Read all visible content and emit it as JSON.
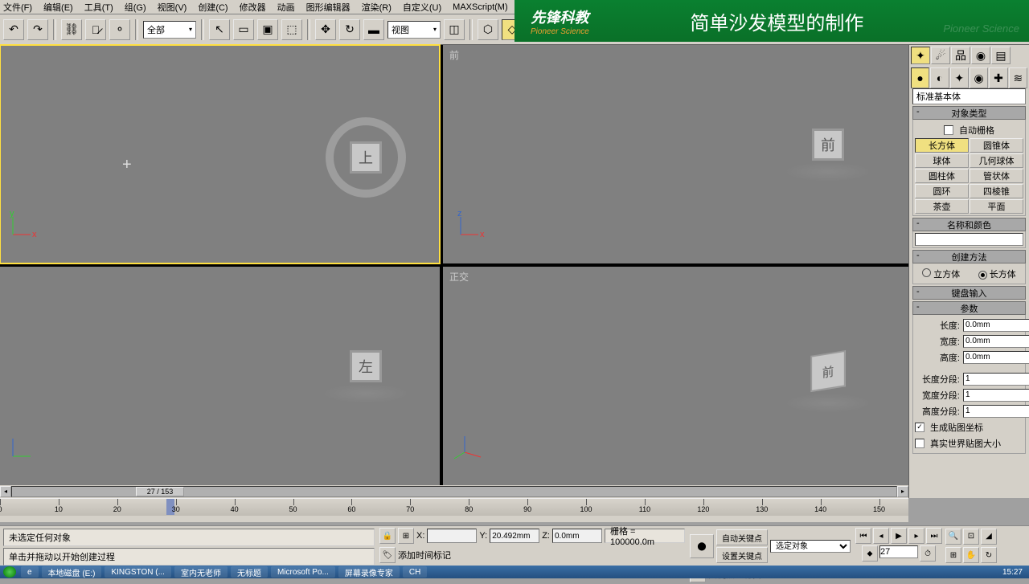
{
  "menu": [
    "文件(F)",
    "编辑(E)",
    "工具(T)",
    "组(G)",
    "视图(V)",
    "创建(C)",
    "修改器",
    "动画",
    "图形编辑器",
    "渲染(R)",
    "自定义(U)",
    "MAXScript(M)"
  ],
  "banner": {
    "logo_cn": "先锋科教",
    "logo_en": "Pioneer Science",
    "title": "简单沙发模型的制作",
    "watermark": "Pioneer Science"
  },
  "toolbar": {
    "sel1": "全部",
    "sel2": "视图"
  },
  "viewports": {
    "top": {
      "label": "",
      "cube": "上"
    },
    "front": {
      "label": "前",
      "cube": "前"
    },
    "left": {
      "label": "",
      "cube": "左"
    },
    "persp": {
      "label": "正交",
      "cube": "前"
    }
  },
  "panel": {
    "subcat": "标准基本体",
    "roll_objtype": "对象类型",
    "autogrid": "自动栅格",
    "prims": [
      "长方体",
      "圆锥体",
      "球体",
      "几何球体",
      "圆柱体",
      "管状体",
      "圆环",
      "四棱锥",
      "茶壶",
      "平面"
    ],
    "roll_name": "名称和颜色",
    "name_value": "",
    "roll_method": "创建方法",
    "method_cube": "立方体",
    "method_box": "长方体",
    "roll_kbd": "键盘输入",
    "roll_params": "参数",
    "length_lbl": "长度:",
    "length_val": "0.0mm",
    "width_lbl": "宽度:",
    "width_val": "0.0mm",
    "height_lbl": "高度:",
    "height_val": "0.0mm",
    "lseg_lbl": "长度分段:",
    "lseg_val": "1",
    "wseg_lbl": "宽度分段:",
    "wseg_val": "1",
    "hseg_lbl": "高度分段:",
    "hseg_val": "1",
    "genmap": "生成贴图坐标",
    "realworld": "真实世界贴图大小"
  },
  "timeline": {
    "pos": "27 / 153",
    "ticks": [
      0,
      10,
      20,
      30,
      40,
      50,
      60,
      70,
      80,
      90,
      100,
      110,
      120,
      130,
      140,
      150
    ]
  },
  "status": {
    "line1": "未选定任何对象",
    "line2": "单击并拖动以开始创建过程",
    "x": "",
    "y": "20.492mm",
    "z": "0.0mm",
    "grid": "栅格 = 100000.0m",
    "addtime": "添加时间标记",
    "autokey": "自动关键点",
    "setkey": "设置关键点",
    "keyfilter": "关键点过滤器",
    "selobj": "选定对象",
    "frame": "27"
  },
  "taskbar": {
    "items": [
      "本地磁盘 (E:)",
      "KINGSTON (...",
      "室内无老师",
      "无标题",
      "Microsoft Po...",
      "屏幕录像专家"
    ],
    "lang": "CH",
    "clock": "15:27"
  }
}
